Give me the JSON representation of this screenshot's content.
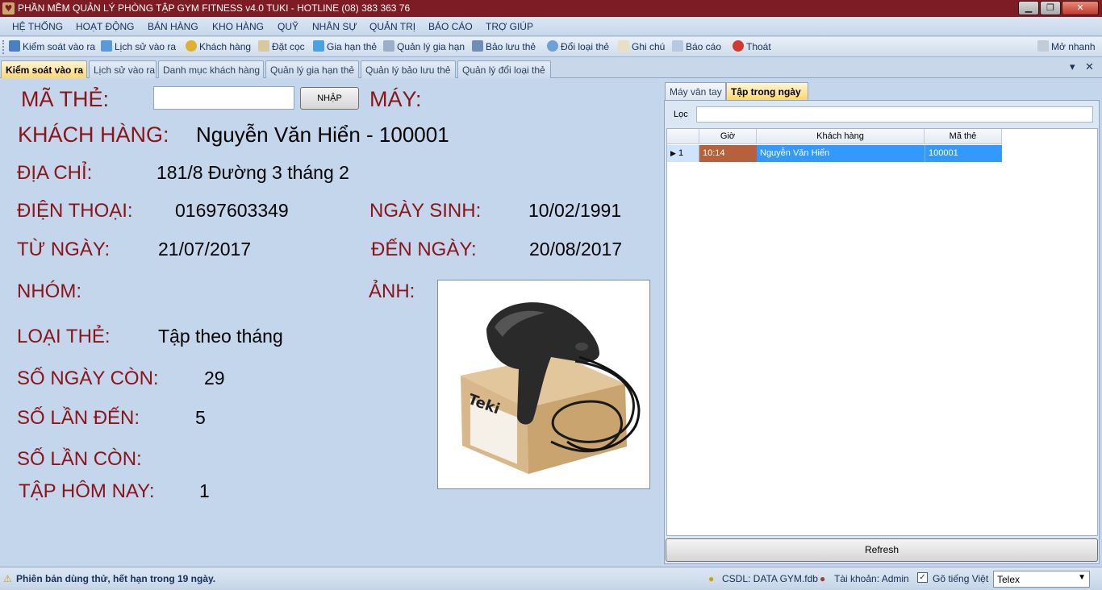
{
  "window": {
    "title": "PHẦN MỀM QUẢN LÝ PHÒNG TẬP GYM FITNESS v4.0 TUKI - HOTLINE (08) 383 363 76"
  },
  "menu": [
    "HỆ THỐNG",
    "HOẠT ĐỘNG",
    "BÁN HÀNG",
    "KHO HÀNG",
    "QUỸ",
    "NHÂN SỰ",
    "QUẢN TRỊ",
    "BÁO CÁO",
    "TRỢ GIÚP"
  ],
  "toolbar": {
    "items": [
      "Kiểm soát vào ra",
      "Lịch sử vào ra",
      "Khách hàng",
      "Đặt cọc",
      "Gia hạn thẻ",
      "Quản lý gia hạn",
      "Bảo lưu thẻ",
      "Đổi loại thẻ",
      "Ghi chú",
      "Báo cáo",
      "Thoát"
    ],
    "quick_open": "Mở nhanh"
  },
  "tabs": [
    "Kiểm soát vào ra",
    "Lịch sử vào ra",
    "Danh mục khách hàng",
    "Quản lý gia hạn thẻ",
    "Quản lý bảo lưu thẻ",
    "Quản lý đổi loại thẻ"
  ],
  "form": {
    "card_label": "MÃ THẺ:",
    "card_value": "",
    "enter_button": "NHẬP",
    "machine_label": "MÁY:",
    "customer_label": "KHÁCH HÀNG:",
    "customer_value": "Nguyễn Văn Hiển - 100001",
    "address_label": "ĐỊA CHỈ:",
    "address_value": "181/8 Đường 3 tháng 2",
    "phone_label": "ĐIỆN THOẠI:",
    "phone_value": "01697603349",
    "birth_label": "NGÀY SINH:",
    "birth_value": "10/02/1991",
    "from_label": "TỪ NGÀY:",
    "from_value": "21/07/2017",
    "to_label": "ĐẾN NGÀY:",
    "to_value": "20/08/2017",
    "group_label": "NHÓM:",
    "photo_label": "ẢNH:",
    "card_type_label": "LOẠI THẺ:",
    "card_type_value": "Tập theo tháng",
    "days_left_label": "SỐ NGÀY CÒN:",
    "days_left_value": "29",
    "visits_label": "SỐ LẦN ĐẾN:",
    "visits_value": "5",
    "visits_left_label": "SỐ LẦN CÒN:",
    "today_label": "TẬP HÔM NAY:",
    "today_value": "1",
    "photo_brand": "Teki"
  },
  "right_panel": {
    "tabs": [
      "Máy vân tay",
      "Tập trong ngày"
    ],
    "filter_label": "Lọc",
    "filter_value": "",
    "columns": [
      "Giờ",
      "Khách hàng",
      "Mã thẻ"
    ],
    "rows": [
      {
        "index": "1",
        "time": "10:14",
        "customer": "Nguyễn Văn Hiển",
        "card": "100001"
      }
    ],
    "refresh_button": "Refresh"
  },
  "status": {
    "trial": "Phiên bản dùng thử, hết hạn trong 19 ngày.",
    "database": "CSDL: DATA GYM.fdb",
    "account": "Tài khoản: Admin",
    "vietnamese_typing": "Gõ tiếng Việt",
    "input_method": "Telex"
  },
  "colors": {
    "title_bar": "#7d1c24",
    "label_red": "#8b1419",
    "selected_row": "#3399ff",
    "time_cell": "#b5623c"
  }
}
